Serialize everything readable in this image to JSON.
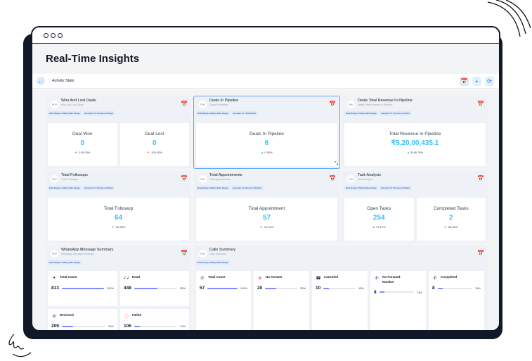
{
  "window": {
    "title": "Real-Time Insights"
  },
  "toolbar": {
    "back": "←",
    "label": "Activity Stats",
    "calendar": "📅",
    "add": "+",
    "refresh": "⟳"
  },
  "icons": {
    "chart": "〰",
    "cal": "📅",
    "down": "▼",
    "up": "▲",
    "expand": "⤡"
  },
  "cards": [
    {
      "title": "Won And Lost Deals",
      "subtitle": "Won And Lost Deals",
      "tags": [
        "Date Range: Rolling Date Range",
        "Compare To: Previous 30 Days"
      ],
      "stats": [
        {
          "label": "Deal Won",
          "value": "0",
          "change": "-100.00%",
          "dir": "down"
        },
        {
          "label": "Deal Lost",
          "value": "0",
          "change": "-100.00%",
          "dir": "down"
        }
      ]
    },
    {
      "title": "Deals In Pipeline",
      "subtitle": "Deals In Pipeline",
      "tags": [
        "Date Range: Rolling Date Range",
        "Compare To: Year Before"
      ],
      "stats": [
        {
          "label": "Deals In Pipeline",
          "value": "6",
          "change": "0.00%",
          "dir": "up"
        }
      ]
    },
    {
      "title": "Deals Total Revenue In Pipeline",
      "subtitle": "Deals Total Revenue In Pipeline",
      "tags": [
        "Date Range: Rolling Date Range",
        "Compare To: Previous 30 Days"
      ],
      "stats": [
        {
          "label": "Total Revenue In Pipeline",
          "value": "₹5,20,00,435.1",
          "change": "3146.79%",
          "dir": "up"
        }
      ]
    },
    {
      "title": "Total Followups",
      "subtitle": "Total Followups",
      "tags": [
        "Date Range: Rolling Date Range",
        "Compare To: Previous 30 Days"
      ],
      "stats": [
        {
          "label": "Total Followup",
          "value": "64",
          "change": "-22.89%",
          "dir": "down"
        }
      ]
    },
    {
      "title": "Total Appointments",
      "subtitle": "Total Appointments",
      "tags": [
        "Date Range: Rolling Date Range",
        "Compare To: Previous 30 Days"
      ],
      "stats": [
        {
          "label": "Total Appointment",
          "value": "57",
          "change": "-10.94%",
          "dir": "down"
        }
      ]
    },
    {
      "title": "Task Analysis",
      "subtitle": "Task Analysis",
      "tags": [
        "Date Range: Rolling Date Range",
        "Compare To: Previous 30 Days"
      ],
      "stats": [
        {
          "label": "Open Tasks",
          "value": "254",
          "change": "75.17%",
          "dir": "up"
        },
        {
          "label": "Completed Tasks",
          "value": "2",
          "change": "-83.33%",
          "dir": "down"
        }
      ]
    },
    {
      "title": "WhatsApp Message Summary",
      "subtitle": "WhatsApp Message Summary",
      "tags": [
        "Date Range: Rolling Date Range"
      ],
      "items": [
        {
          "icon": "◕",
          "label": "Total Count",
          "value": "813",
          "pct": "100%",
          "frac": 1.0
        },
        {
          "icon": "✓✓",
          "label": "Read",
          "value": "448",
          "pct": "55%",
          "frac": 0.55
        },
        {
          "icon": "⊘",
          "label": "Recieved",
          "value": "209",
          "pct": "26%",
          "frac": 0.26
        },
        {
          "icon": "ⓘ",
          "label": "Failed",
          "value": "106",
          "pct": "13%",
          "frac": 0.13
        }
      ]
    },
    {
      "title": "Calls Summary",
      "subtitle": "Calls Summary",
      "tags": [
        "Date Range: Rolling Date Range"
      ],
      "items": [
        {
          "icon": "✆",
          "label": "Total Count",
          "value": "57",
          "pct": "100%",
          "frac": 1.0
        },
        {
          "icon": "⊗",
          "label": "No-Answer",
          "value": "20",
          "pct": "35%",
          "frac": 0.35
        },
        {
          "icon": "☎",
          "label": "Canceled",
          "value": "10",
          "pct": "18%",
          "frac": 0.18
        },
        {
          "icon": "✆",
          "label": "No-Forward-Number",
          "value": "8",
          "pct": "14%",
          "frac": 0.14
        },
        {
          "icon": "✆",
          "label": "Completed",
          "value": "8",
          "pct": "14%",
          "frac": 0.14
        }
      ]
    }
  ]
}
